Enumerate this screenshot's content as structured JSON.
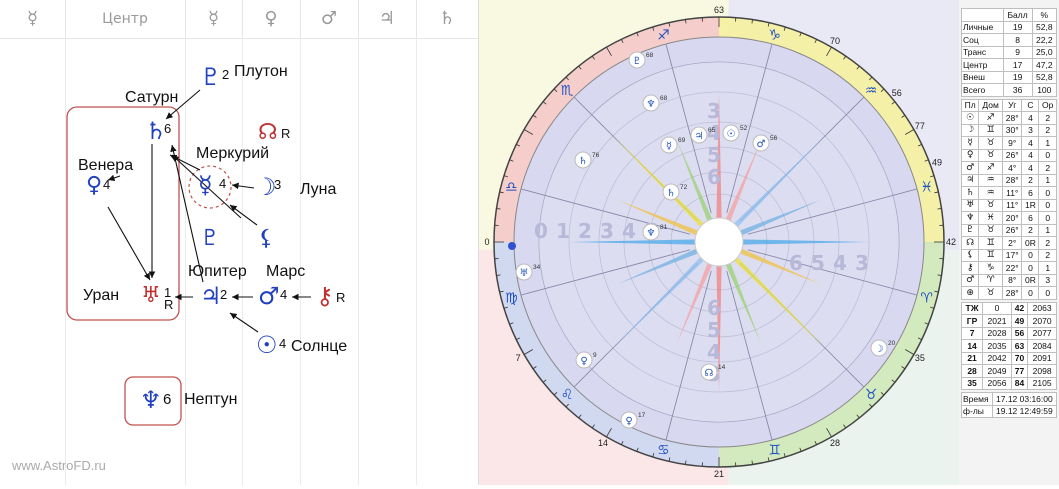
{
  "left_header": {
    "columns": [
      "☿",
      "Центр",
      "☿",
      "♀",
      "♂",
      "♃",
      "♄"
    ]
  },
  "planets": {
    "pluto": {
      "glyph": "♇",
      "label": "Плутон",
      "num": "2"
    },
    "saturn": {
      "glyph": "♄",
      "label": "Сатурн",
      "num": "6"
    },
    "node": {
      "glyph": "☊",
      "num": "R"
    },
    "mercury": {
      "glyph": "☿",
      "label": "Меркурий",
      "num": "4"
    },
    "venus": {
      "glyph": "♀",
      "label": "Венера",
      "num": "4"
    },
    "moon": {
      "glyph": "☽",
      "label": "Луна",
      "num": "3"
    },
    "lilith": {
      "glyph": "⚸"
    },
    "pluto2": {
      "glyph": "♇"
    },
    "uranus": {
      "glyph": "♅",
      "label": "Уран",
      "num": "1",
      "sub": "R"
    },
    "jupiter": {
      "glyph": "♃",
      "label": "Юпитер",
      "num": "2"
    },
    "mars": {
      "glyph": "♂",
      "label": "Марс",
      "num": "4"
    },
    "chiron": {
      "glyph": "⚷",
      "num": "R"
    },
    "sun": {
      "glyph": "☉",
      "label": "Солнце",
      "num": "4"
    },
    "neptune": {
      "glyph": "♆",
      "label": "Нептун",
      "num": "6"
    }
  },
  "watermark": "www.AstroFD.ru",
  "wheel": {
    "degree_labels": [
      "63",
      "70",
      "77",
      "0",
      "7",
      "14",
      "21",
      "28",
      "35",
      "42",
      "49",
      "56"
    ],
    "numbers_left": [
      "0",
      "1",
      "2",
      "3",
      "4",
      "5"
    ],
    "numbers_right": [
      "6",
      "5",
      "4",
      "3"
    ],
    "numbers_top": [
      "3",
      "4",
      "5",
      "6"
    ],
    "numbers_bottom": [
      "6",
      "5",
      "4",
      "3"
    ],
    "inner_points": [
      {
        "g": "♇",
        "n": "68"
      },
      {
        "g": "♆",
        "n": "68"
      },
      {
        "g": "☿",
        "n": "69"
      },
      {
        "g": "♃",
        "n": "65"
      },
      {
        "g": "☉",
        "n": "52"
      },
      {
        "g": "♂",
        "n": "56"
      },
      {
        "g": "♄",
        "n": "76"
      },
      {
        "g": "♄",
        "n": "72"
      },
      {
        "g": "♆",
        "n": "81"
      },
      {
        "g": "♅",
        "n": "34"
      },
      {
        "g": "☽",
        "n": "20"
      },
      {
        "g": "♀",
        "n": "9"
      },
      {
        "g": "☊",
        "n": "14"
      },
      {
        "g": "♀",
        "n": "17"
      }
    ],
    "signs": [
      "♑",
      "♒",
      "♓",
      "♈",
      "♉",
      "♊",
      "♋",
      "♌",
      "♍",
      "♎",
      "♏",
      "♐"
    ]
  },
  "scores": {
    "headers": [
      "",
      "Балл",
      "%"
    ],
    "rows": [
      [
        "Личные",
        "19",
        "52,8"
      ],
      [
        "Соц",
        "8",
        "22,2"
      ],
      [
        "Транс",
        "9",
        "25,0"
      ],
      [
        "Центр",
        "17",
        "47,2"
      ],
      [
        "Внеш",
        "19",
        "52,8"
      ],
      [
        "Всего",
        "36",
        "100"
      ]
    ]
  },
  "planet_table": {
    "headers": [
      "Пл",
      "Дом",
      "Уг",
      "С",
      "Ор"
    ],
    "rows": [
      [
        "☉",
        "♐",
        "28°",
        "4",
        "2"
      ],
      [
        "☽",
        "♊",
        "30°",
        "3",
        "2"
      ],
      [
        "☿",
        "♉",
        "9°",
        "4",
        "1"
      ],
      [
        "♀",
        "♉",
        "26°",
        "4",
        "0"
      ],
      [
        "♂",
        "♐",
        "4°",
        "4",
        "2"
      ],
      [
        "♃",
        "♒",
        "28°",
        "2",
        "1"
      ],
      [
        "♄",
        "♒",
        "11°",
        "6",
        "0"
      ],
      [
        "♅",
        "♉",
        "11°",
        "1R",
        "0"
      ],
      [
        "♆",
        "♓",
        "20°",
        "6",
        "0"
      ],
      [
        "♇",
        "♉",
        "26°",
        "2",
        "1"
      ],
      [
        "☊",
        "♊",
        "2°",
        "0R",
        "2"
      ],
      [
        "⚸",
        "♊",
        "17°",
        "0",
        "2"
      ],
      [
        "⚷",
        "♑",
        "22°",
        "0",
        "1"
      ],
      [
        "♂",
        "♈",
        "8°",
        "0R",
        "3"
      ],
      [
        "⊕",
        "♉",
        "28°",
        "0",
        "0"
      ]
    ]
  },
  "years_table": {
    "rows": [
      [
        "ТЖ",
        "0",
        "42",
        "2063"
      ],
      [
        "ГР",
        "2021",
        "49",
        "2070"
      ],
      [
        "7",
        "2028",
        "56",
        "2077"
      ],
      [
        "14",
        "2035",
        "63",
        "2084"
      ],
      [
        "21",
        "2042",
        "70",
        "2091"
      ],
      [
        "28",
        "2049",
        "77",
        "2098"
      ],
      [
        "35",
        "2056",
        "84",
        "2105"
      ]
    ]
  },
  "footer": {
    "time_label": "Время",
    "time_value": "17.12 03:16:00",
    "fl_label": "ф-лы",
    "fl_value": "19.12 12:49:59"
  }
}
